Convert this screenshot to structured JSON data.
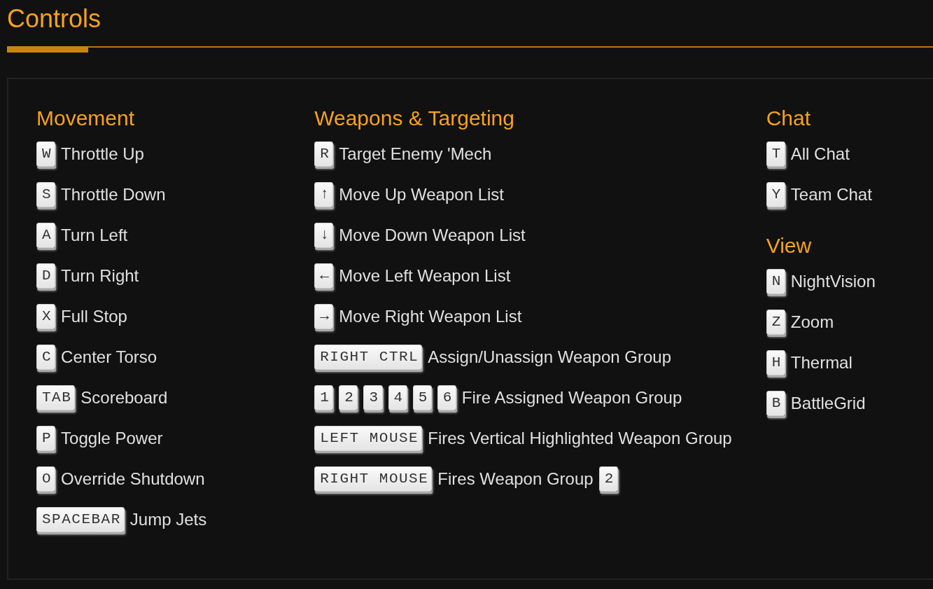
{
  "title": "Controls",
  "columns": [
    {
      "sections": [
        {
          "heading": "Movement",
          "rows": [
            {
              "parts": [
                {
                  "kind": "key",
                  "text": "W"
                },
                {
                  "kind": "text",
                  "text": "Throttle Up"
                }
              ]
            },
            {
              "parts": [
                {
                  "kind": "key",
                  "text": "S"
                },
                {
                  "kind": "text",
                  "text": "Throttle Down"
                }
              ]
            },
            {
              "parts": [
                {
                  "kind": "key",
                  "text": "A"
                },
                {
                  "kind": "text",
                  "text": "Turn Left"
                }
              ]
            },
            {
              "parts": [
                {
                  "kind": "key",
                  "text": "D"
                },
                {
                  "kind": "text",
                  "text": "Turn Right"
                }
              ]
            },
            {
              "parts": [
                {
                  "kind": "key",
                  "text": "X"
                },
                {
                  "kind": "text",
                  "text": "Full Stop"
                }
              ]
            },
            {
              "parts": [
                {
                  "kind": "key",
                  "text": "C"
                },
                {
                  "kind": "text",
                  "text": "Center Torso"
                }
              ]
            },
            {
              "parts": [
                {
                  "kind": "key",
                  "text": "TAB"
                },
                {
                  "kind": "text",
                  "text": "Scoreboard"
                }
              ]
            },
            {
              "parts": [
                {
                  "kind": "key",
                  "text": "P"
                },
                {
                  "kind": "text",
                  "text": "Toggle Power"
                }
              ]
            },
            {
              "parts": [
                {
                  "kind": "key",
                  "text": "O"
                },
                {
                  "kind": "text",
                  "text": "Override Shutdown"
                }
              ]
            },
            {
              "parts": [
                {
                  "kind": "key",
                  "text": "SPACEBAR"
                },
                {
                  "kind": "text",
                  "text": "Jump Jets"
                }
              ]
            }
          ]
        }
      ]
    },
    {
      "sections": [
        {
          "heading": "Weapons & Targeting",
          "rows": [
            {
              "parts": [
                {
                  "kind": "key",
                  "text": "R"
                },
                {
                  "kind": "text",
                  "text": "Target Enemy 'Mech"
                }
              ]
            },
            {
              "parts": [
                {
                  "kind": "key",
                  "text": "↑"
                },
                {
                  "kind": "text",
                  "text": "Move Up Weapon List"
                }
              ]
            },
            {
              "parts": [
                {
                  "kind": "key",
                  "text": "↓"
                },
                {
                  "kind": "text",
                  "text": "Move Down Weapon List"
                }
              ]
            },
            {
              "parts": [
                {
                  "kind": "key",
                  "text": "←"
                },
                {
                  "kind": "text",
                  "text": "Move Left Weapon List"
                }
              ]
            },
            {
              "parts": [
                {
                  "kind": "key",
                  "text": "→"
                },
                {
                  "kind": "text",
                  "text": "Move Right Weapon List"
                }
              ]
            },
            {
              "parts": [
                {
                  "kind": "key",
                  "text": "RIGHT CTRL"
                },
                {
                  "kind": "text",
                  "text": "Assign/Unassign Weapon Group"
                }
              ]
            },
            {
              "parts": [
                {
                  "kind": "key",
                  "text": "1"
                },
                {
                  "kind": "key",
                  "text": "2"
                },
                {
                  "kind": "key",
                  "text": "3"
                },
                {
                  "kind": "key",
                  "text": "4"
                },
                {
                  "kind": "key",
                  "text": "5"
                },
                {
                  "kind": "key",
                  "text": "6"
                },
                {
                  "kind": "text",
                  "text": "Fire Assigned Weapon Group"
                }
              ]
            },
            {
              "parts": [
                {
                  "kind": "key",
                  "text": "LEFT MOUSE"
                },
                {
                  "kind": "text",
                  "text": "Fires Vertical Highlighted Weapon Group"
                }
              ]
            },
            {
              "parts": [
                {
                  "kind": "key",
                  "text": "RIGHT MOUSE"
                },
                {
                  "kind": "text",
                  "text": "Fires Weapon Group"
                },
                {
                  "kind": "key",
                  "text": "2"
                }
              ]
            }
          ]
        }
      ]
    },
    {
      "sections": [
        {
          "heading": "Chat",
          "rows": [
            {
              "parts": [
                {
                  "kind": "key",
                  "text": "T"
                },
                {
                  "kind": "text",
                  "text": "All Chat"
                }
              ]
            },
            {
              "parts": [
                {
                  "kind": "key",
                  "text": "Y"
                },
                {
                  "kind": "text",
                  "text": "Team Chat"
                }
              ]
            }
          ]
        },
        {
          "heading": "View",
          "rows": [
            {
              "parts": [
                {
                  "kind": "key",
                  "text": "N"
                },
                {
                  "kind": "text",
                  "text": "NightVision"
                }
              ]
            },
            {
              "parts": [
                {
                  "kind": "key",
                  "text": "Z"
                },
                {
                  "kind": "text",
                  "text": "Zoom"
                }
              ]
            },
            {
              "parts": [
                {
                  "kind": "key",
                  "text": "H"
                },
                {
                  "kind": "text",
                  "text": "Thermal"
                }
              ]
            },
            {
              "parts": [
                {
                  "kind": "key",
                  "text": "B"
                },
                {
                  "kind": "text",
                  "text": "BattleGrid"
                }
              ]
            }
          ]
        }
      ]
    }
  ]
}
